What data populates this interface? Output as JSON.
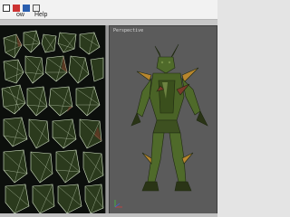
{
  "menubar": {
    "items": [
      {
        "label": "ow",
        "name": "menu-window"
      },
      {
        "label": "Help",
        "name": "menu-help"
      }
    ]
  },
  "viewport": {
    "label": "Perspective"
  },
  "colors": {
    "uv_background": "#0c0f0c",
    "uv_wire": "#d6e6c8",
    "viewport_background": "#5b5b5b",
    "model_green": "#4f6a2a",
    "model_dark": "#2a3416",
    "model_accent": "#b8862e"
  },
  "icons": [
    "tool-select-icon",
    "tool-move-icon",
    "tool-scale-icon",
    "tool-rotate-icon"
  ]
}
